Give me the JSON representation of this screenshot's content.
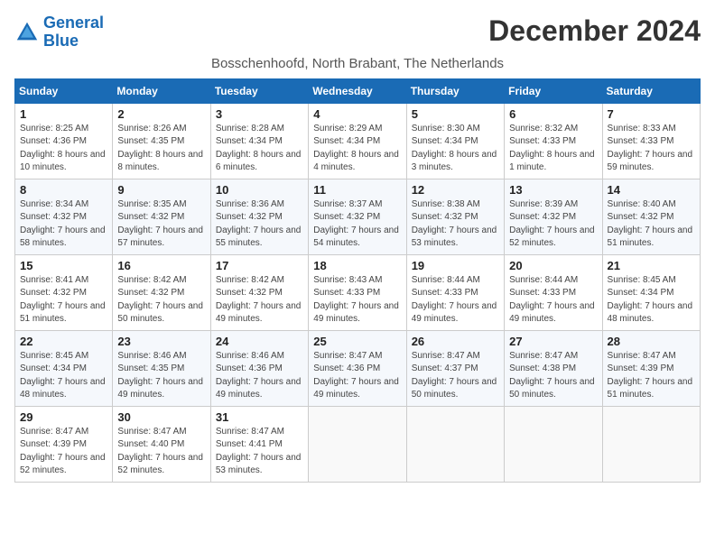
{
  "logo": {
    "line1": "General",
    "line2": "Blue"
  },
  "title": "December 2024",
  "subtitle": "Bosschenhoofd, North Brabant, The Netherlands",
  "weekdays": [
    "Sunday",
    "Monday",
    "Tuesday",
    "Wednesday",
    "Thursday",
    "Friday",
    "Saturday"
  ],
  "weeks": [
    [
      {
        "day": "1",
        "sunrise": "8:25 AM",
        "sunset": "4:36 PM",
        "daylight": "8 hours and 10 minutes."
      },
      {
        "day": "2",
        "sunrise": "8:26 AM",
        "sunset": "4:35 PM",
        "daylight": "8 hours and 8 minutes."
      },
      {
        "day": "3",
        "sunrise": "8:28 AM",
        "sunset": "4:34 PM",
        "daylight": "8 hours and 6 minutes."
      },
      {
        "day": "4",
        "sunrise": "8:29 AM",
        "sunset": "4:34 PM",
        "daylight": "8 hours and 4 minutes."
      },
      {
        "day": "5",
        "sunrise": "8:30 AM",
        "sunset": "4:34 PM",
        "daylight": "8 hours and 3 minutes."
      },
      {
        "day": "6",
        "sunrise": "8:32 AM",
        "sunset": "4:33 PM",
        "daylight": "8 hours and 1 minute."
      },
      {
        "day": "7",
        "sunrise": "8:33 AM",
        "sunset": "4:33 PM",
        "daylight": "7 hours and 59 minutes."
      }
    ],
    [
      {
        "day": "8",
        "sunrise": "8:34 AM",
        "sunset": "4:32 PM",
        "daylight": "7 hours and 58 minutes."
      },
      {
        "day": "9",
        "sunrise": "8:35 AM",
        "sunset": "4:32 PM",
        "daylight": "7 hours and 57 minutes."
      },
      {
        "day": "10",
        "sunrise": "8:36 AM",
        "sunset": "4:32 PM",
        "daylight": "7 hours and 55 minutes."
      },
      {
        "day": "11",
        "sunrise": "8:37 AM",
        "sunset": "4:32 PM",
        "daylight": "7 hours and 54 minutes."
      },
      {
        "day": "12",
        "sunrise": "8:38 AM",
        "sunset": "4:32 PM",
        "daylight": "7 hours and 53 minutes."
      },
      {
        "day": "13",
        "sunrise": "8:39 AM",
        "sunset": "4:32 PM",
        "daylight": "7 hours and 52 minutes."
      },
      {
        "day": "14",
        "sunrise": "8:40 AM",
        "sunset": "4:32 PM",
        "daylight": "7 hours and 51 minutes."
      }
    ],
    [
      {
        "day": "15",
        "sunrise": "8:41 AM",
        "sunset": "4:32 PM",
        "daylight": "7 hours and 51 minutes."
      },
      {
        "day": "16",
        "sunrise": "8:42 AM",
        "sunset": "4:32 PM",
        "daylight": "7 hours and 50 minutes."
      },
      {
        "day": "17",
        "sunrise": "8:42 AM",
        "sunset": "4:32 PM",
        "daylight": "7 hours and 49 minutes."
      },
      {
        "day": "18",
        "sunrise": "8:43 AM",
        "sunset": "4:33 PM",
        "daylight": "7 hours and 49 minutes."
      },
      {
        "day": "19",
        "sunrise": "8:44 AM",
        "sunset": "4:33 PM",
        "daylight": "7 hours and 49 minutes."
      },
      {
        "day": "20",
        "sunrise": "8:44 AM",
        "sunset": "4:33 PM",
        "daylight": "7 hours and 49 minutes."
      },
      {
        "day": "21",
        "sunrise": "8:45 AM",
        "sunset": "4:34 PM",
        "daylight": "7 hours and 48 minutes."
      }
    ],
    [
      {
        "day": "22",
        "sunrise": "8:45 AM",
        "sunset": "4:34 PM",
        "daylight": "7 hours and 48 minutes."
      },
      {
        "day": "23",
        "sunrise": "8:46 AM",
        "sunset": "4:35 PM",
        "daylight": "7 hours and 49 minutes."
      },
      {
        "day": "24",
        "sunrise": "8:46 AM",
        "sunset": "4:36 PM",
        "daylight": "7 hours and 49 minutes."
      },
      {
        "day": "25",
        "sunrise": "8:47 AM",
        "sunset": "4:36 PM",
        "daylight": "7 hours and 49 minutes."
      },
      {
        "day": "26",
        "sunrise": "8:47 AM",
        "sunset": "4:37 PM",
        "daylight": "7 hours and 50 minutes."
      },
      {
        "day": "27",
        "sunrise": "8:47 AM",
        "sunset": "4:38 PM",
        "daylight": "7 hours and 50 minutes."
      },
      {
        "day": "28",
        "sunrise": "8:47 AM",
        "sunset": "4:39 PM",
        "daylight": "7 hours and 51 minutes."
      }
    ],
    [
      {
        "day": "29",
        "sunrise": "8:47 AM",
        "sunset": "4:39 PM",
        "daylight": "7 hours and 52 minutes."
      },
      {
        "day": "30",
        "sunrise": "8:47 AM",
        "sunset": "4:40 PM",
        "daylight": "7 hours and 52 minutes."
      },
      {
        "day": "31",
        "sunrise": "8:47 AM",
        "sunset": "4:41 PM",
        "daylight": "7 hours and 53 minutes."
      },
      null,
      null,
      null,
      null
    ]
  ]
}
